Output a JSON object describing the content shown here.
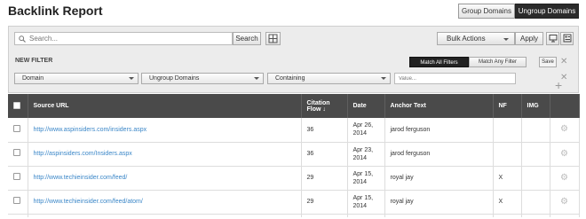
{
  "header": {
    "title": "Backlink Report",
    "group_domains": "Group Domains",
    "ungroup_domains": "Ungroup Domains"
  },
  "toolbar": {
    "search_placeholder": "Search...",
    "search_button": "Search",
    "bulk_actions": "Bulk Actions",
    "apply": "Apply"
  },
  "filter": {
    "title": "NEW FILTER",
    "match_all": "Match All Filters",
    "match_any": "Match Any Filter",
    "save": "Save",
    "field": "Domain",
    "grouping": "Ungroup Domains",
    "operator": "Containing",
    "value_placeholder": "Value..."
  },
  "table": {
    "headers": {
      "source_url": "Source URL",
      "citation_flow": "Citation Flow ↓",
      "date": "Date",
      "anchor_text": "Anchor Text",
      "nf": "NF",
      "img": "IMG"
    },
    "rows": [
      {
        "url": "http://www.aspinsiders.com/insiders.aspx",
        "cf": "36",
        "date": "Apr 26, 2014",
        "anchor": "jarod ferguson",
        "nf": "",
        "img": ""
      },
      {
        "url": "http://aspinsiders.com/Insiders.aspx",
        "cf": "36",
        "date": "Apr 23, 2014",
        "anchor": "jarod ferguson",
        "nf": "",
        "img": ""
      },
      {
        "url": "http://www.techieinsider.com/feed/",
        "cf": "29",
        "date": "Apr 15, 2014",
        "anchor": "royal jay",
        "nf": "X",
        "img": ""
      },
      {
        "url": "http://www.techieinsider.com/feed/atom/",
        "cf": "29",
        "date": "Apr 15, 2014",
        "anchor": "royal jay",
        "nf": "X",
        "img": ""
      }
    ]
  },
  "icons": {
    "search": "search-icon",
    "columns": "columns-icon",
    "monitor": "monitor-icon",
    "grid": "grid-view-icon",
    "close": "close-icon",
    "add": "plus-icon",
    "settings": "gear-icon"
  },
  "colors": {
    "header_bg": "#4a4a4a",
    "link": "#3b87c8",
    "active_toggle": "#2b2b2b"
  }
}
